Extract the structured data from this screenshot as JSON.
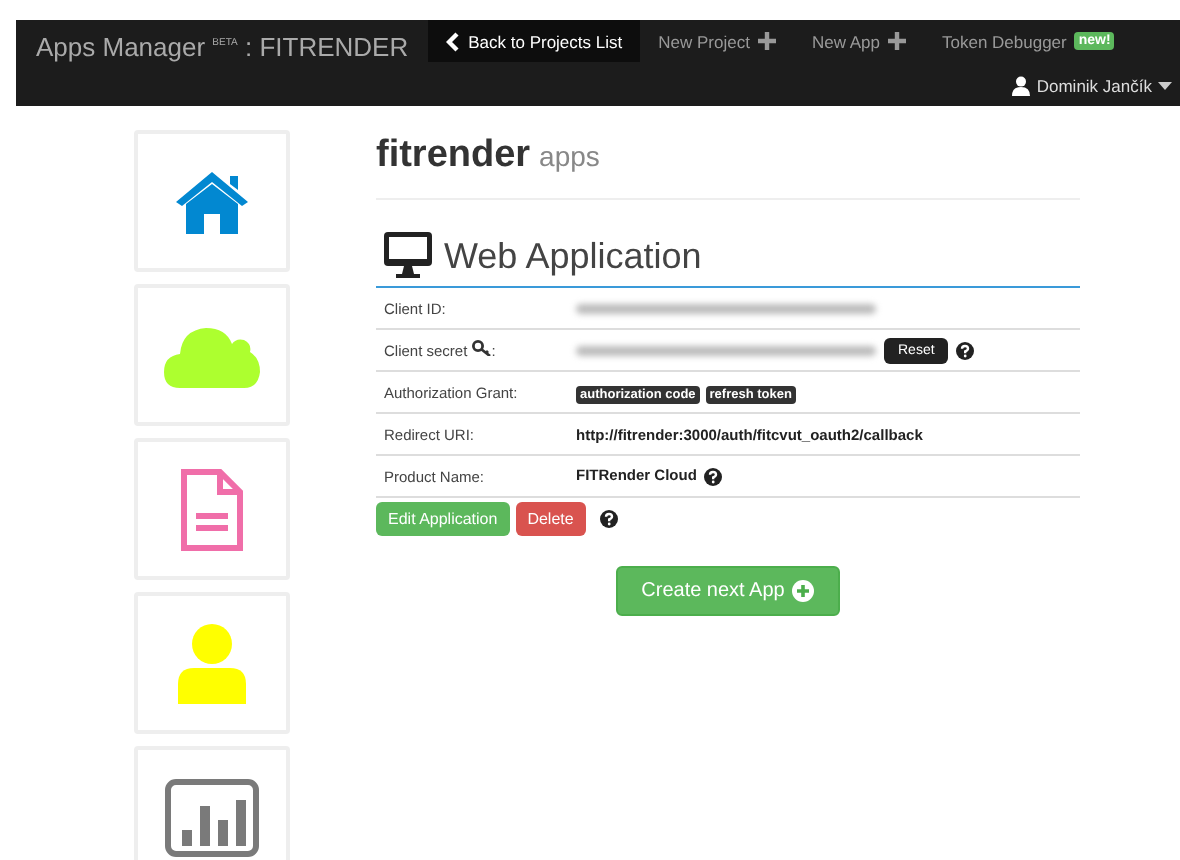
{
  "navbar": {
    "brand": "Apps Manager",
    "brand_sup": "BETA",
    "project": ": FITRENDER",
    "items": [
      {
        "label": "Back to Projects List",
        "kind": "back",
        "selected": true
      },
      {
        "label": "New Project",
        "kind": "add",
        "selected": false
      },
      {
        "label": "New App",
        "kind": "add",
        "selected": false
      },
      {
        "label": "Token Debugger",
        "kind": "badge",
        "badge": "new!",
        "selected": false
      }
    ],
    "user": "Dominik Jančík"
  },
  "sidebar": [
    {
      "kind": "house",
      "color": "#0288d1"
    },
    {
      "kind": "cloud",
      "color": "#adff2f"
    },
    {
      "kind": "document",
      "color": "#f06ea9"
    },
    {
      "kind": "person",
      "color": "#ffff00"
    },
    {
      "kind": "chart",
      "color": "#7a7a7a"
    }
  ],
  "page_title": "fitrender",
  "page_subtitle": "apps",
  "section_title": "Web Application",
  "rows": [
    {
      "label": "Client ID:",
      "kind": "blurred"
    },
    {
      "label": "Client secret",
      "label_end": ":",
      "kind": "secret",
      "button": "Reset"
    },
    {
      "label": "Authorization Grant:",
      "kind": "tags",
      "tags": [
        "authorization code",
        "refresh token"
      ]
    },
    {
      "label": "Redirect URI:",
      "kind": "text",
      "value": "http://fitrender:3000/auth/fitcvut_oauth2/callback"
    },
    {
      "label": "Product Name:",
      "kind": "text",
      "value": "FITRender Cloud",
      "help": true
    }
  ],
  "actions": {
    "edit": "Edit Application",
    "delete": "Delete"
  },
  "create_button": "Create next App"
}
